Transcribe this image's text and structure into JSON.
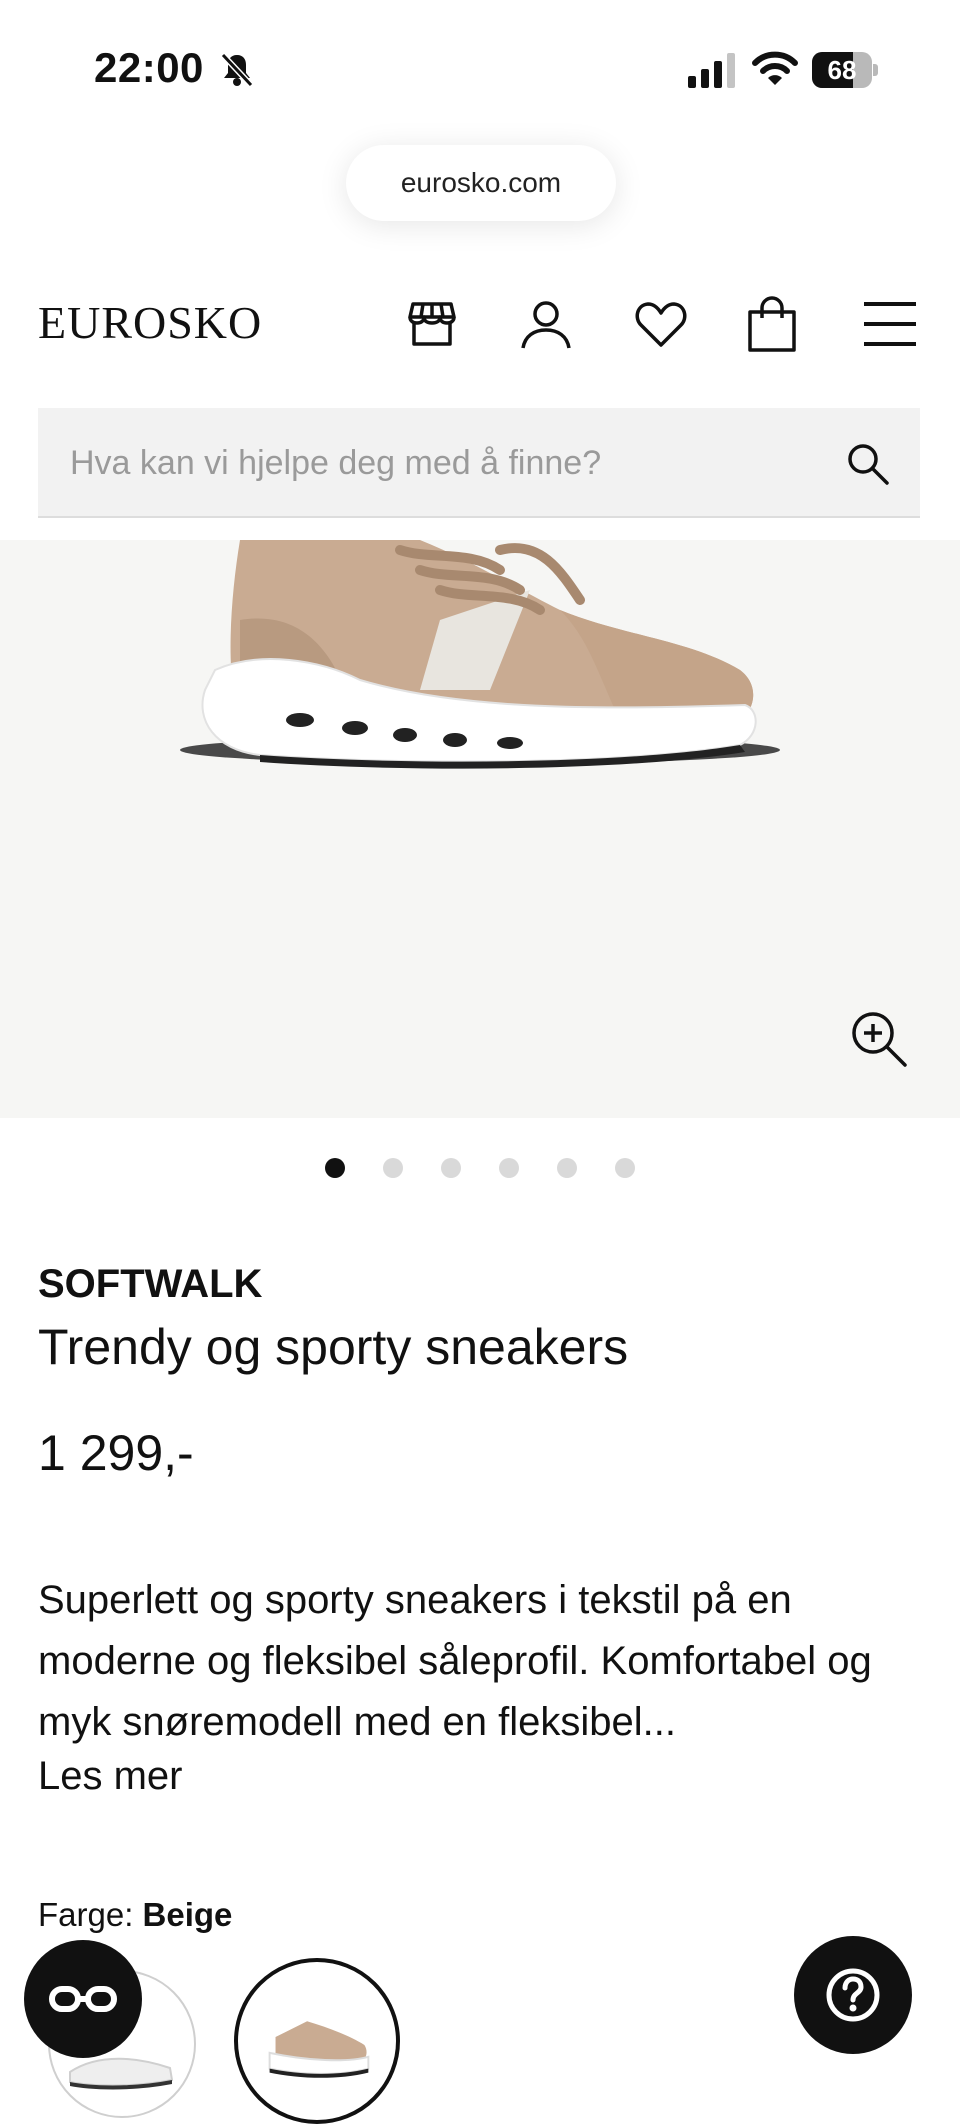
{
  "status_bar": {
    "time": "22:00",
    "battery_percent": "68",
    "battery_level": 0.68,
    "icons": [
      "bell-off-icon",
      "signal-icon",
      "wifi-icon",
      "battery-icon"
    ]
  },
  "browser": {
    "url": "eurosko.com"
  },
  "header": {
    "logo": "EUROSKO",
    "icons": [
      "store-icon",
      "account-icon",
      "heart-icon",
      "bag-icon",
      "menu-icon"
    ]
  },
  "search": {
    "placeholder": "Hva kan vi hjelpe deg med å finne?",
    "value": ""
  },
  "gallery": {
    "total_images": 6,
    "active_index": 0
  },
  "product": {
    "brand": "SOFTWALK",
    "title": "Trendy og sporty sneakers",
    "price": "1 299,-",
    "description": "Superlett og sporty sneakers i tekstil på en moderne og fleksibel såleprofil. Komfortabel og myk snøremodell med en fleksibel...",
    "read_more": "Les mer",
    "color_label": "Farge:",
    "color_value": "Beige"
  },
  "colors": {
    "accent": "#111111",
    "image_bg": "#f6f6f4",
    "shoe_beige": "#c9ab92",
    "search_bg": "#f2f2f2"
  }
}
